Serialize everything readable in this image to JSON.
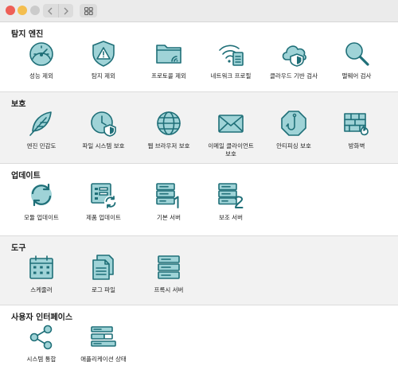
{
  "sections": [
    {
      "title": "탐지 엔진",
      "items": [
        {
          "label": "성능 제외",
          "icon": "speedometer-icon"
        },
        {
          "label": "탐지 제외",
          "icon": "shield-warning-icon"
        },
        {
          "label": "프로토콜 제외",
          "icon": "folder-signal-icon"
        },
        {
          "label": "네트워크 프로필",
          "icon": "wifi-profile-icon"
        },
        {
          "label": "클라우드 기반 검사",
          "icon": "cloud-shield-icon"
        },
        {
          "label": "맬웨어 검사",
          "icon": "magnifier-icon"
        }
      ]
    },
    {
      "title": "보호",
      "items": [
        {
          "label": "엔진 민감도",
          "icon": "feather-icon"
        },
        {
          "label": "파일 시스템 보호",
          "icon": "clock-shield-icon"
        },
        {
          "label": "웹 브라우저 보호",
          "icon": "globe-icon"
        },
        {
          "label": "이메일 클라이언트\n보호",
          "icon": "envelope-icon"
        },
        {
          "label": "안티피싱 보호",
          "icon": "hook-octagon-icon"
        },
        {
          "label": "방화벽",
          "icon": "firewall-icon"
        }
      ]
    },
    {
      "title": "업데이트",
      "items": [
        {
          "label": "모듈 업데이트",
          "icon": "sync-icon"
        },
        {
          "label": "제품 업데이트",
          "icon": "app-update-icon"
        },
        {
          "label": "기본 서버",
          "icon": "server-1-icon"
        },
        {
          "label": "보조 서버",
          "icon": "server-2-icon"
        }
      ]
    },
    {
      "title": "도구",
      "items": [
        {
          "label": "스케줄러",
          "icon": "calendar-icon"
        },
        {
          "label": "로그 파일",
          "icon": "documents-icon"
        },
        {
          "label": "프록시 서버",
          "icon": "proxy-server-icon"
        }
      ]
    },
    {
      "title": "사용자 인터페이스",
      "items": [
        {
          "label": "시스템 통합",
          "icon": "share-nodes-icon"
        },
        {
          "label": "애플리케이션 상태",
          "icon": "app-status-icon"
        }
      ]
    }
  ],
  "colors": {
    "icon_fill": "#9fd3d7",
    "icon_stroke": "#1f6f78",
    "section_alt_bg": "#f2f2f2"
  }
}
